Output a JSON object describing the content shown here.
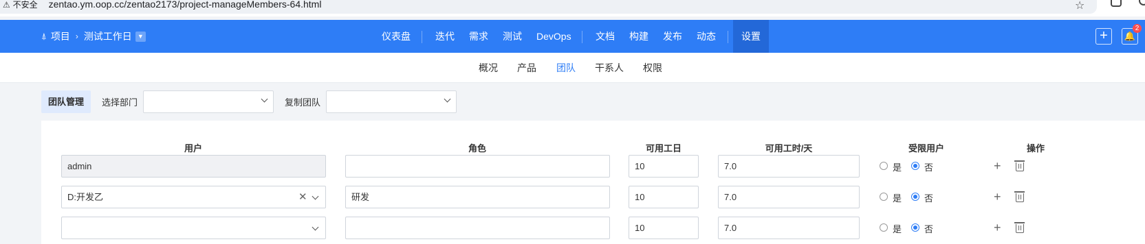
{
  "browser": {
    "warning_label": "不安全",
    "url": "zentao.ym.oop.cc/zentao2173/project-manageMembers-64.html"
  },
  "nav": {
    "project_label": "项目",
    "current_project": "测试工作日",
    "menu": [
      "仪表盘",
      "迭代",
      "需求",
      "测试",
      "DevOps",
      "文档",
      "构建",
      "发布",
      "动态",
      "设置"
    ],
    "active_menu": "设置",
    "notification_count": "2"
  },
  "subnav": {
    "items": [
      "概况",
      "产品",
      "团队",
      "干系人",
      "权限"
    ],
    "active": "团队"
  },
  "toolbar": {
    "team_tab": "团队管理",
    "dept_label": "选择部门",
    "dept_value": "",
    "copy_label": "复制团队",
    "copy_value": ""
  },
  "table": {
    "headers": [
      "用户",
      "角色",
      "可用工日",
      "可用工时/天",
      "受限用户",
      "操作"
    ],
    "radio_yes": "是",
    "radio_no": "否",
    "rows": [
      {
        "user": "admin",
        "role": "",
        "days": "10",
        "hours": "7.0",
        "limited": "no"
      },
      {
        "user": "D:开发乙",
        "role": "研发",
        "days": "10",
        "hours": "7.0",
        "limited": "no"
      },
      {
        "user": "",
        "role": "",
        "days": "10",
        "hours": "7.0",
        "limited": "no"
      }
    ]
  },
  "colors": {
    "primary": "#2e7df6",
    "nav_active": "#2368d8",
    "badge": "#ff4d4f"
  }
}
